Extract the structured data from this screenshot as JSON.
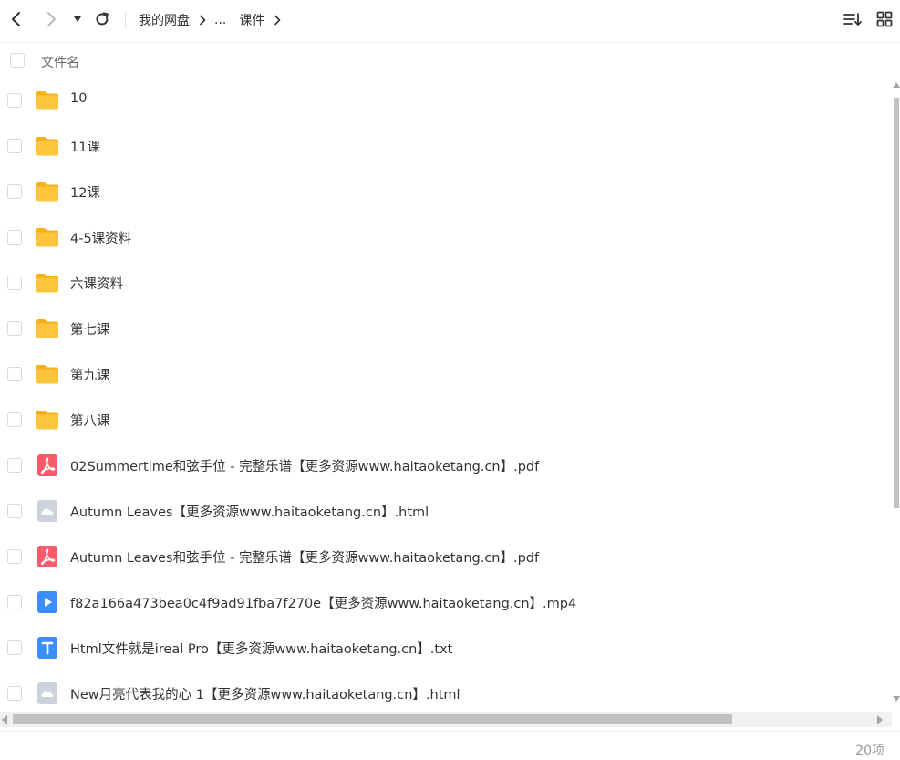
{
  "toolbar": {
    "breadcrumb": [
      {
        "label": "我的网盘"
      },
      {
        "label": "..."
      },
      {
        "label": "课件"
      }
    ]
  },
  "header": {
    "name_column": "文件名"
  },
  "files": [
    {
      "name": "10",
      "type": "folder"
    },
    {
      "name": "11课",
      "type": "folder"
    },
    {
      "name": "12课",
      "type": "folder"
    },
    {
      "name": "4-5课资料",
      "type": "folder"
    },
    {
      "name": "六课资料",
      "type": "folder"
    },
    {
      "name": "第七课",
      "type": "folder"
    },
    {
      "name": "第九课",
      "type": "folder"
    },
    {
      "name": "第八课",
      "type": "folder"
    },
    {
      "name": "02Summertime和弦手位 - 完整乐谱【更多资源www.haitaoketang.cn】.pdf",
      "type": "pdf"
    },
    {
      "name": "Autumn Leaves【更多资源www.haitaoketang.cn】.html",
      "type": "html"
    },
    {
      "name": "Autumn Leaves和弦手位 - 完整乐谱【更多资源www.haitaoketang.cn】.pdf",
      "type": "pdf"
    },
    {
      "name": "f82a166a473bea0c4f9ad91fba7f270e【更多资源www.haitaoketang.cn】.mp4",
      "type": "video"
    },
    {
      "name": "Html文件就是ireal Pro【更多资源www.haitaoketang.cn】.txt",
      "type": "txt"
    },
    {
      "name": "New月亮代表我的心 1【更多资源www.haitaoketang.cn】.html",
      "type": "html"
    }
  ],
  "footer": {
    "item_count": "20项"
  },
  "colors": {
    "folder": "#FFC53D",
    "folder_tab": "#F5B11A",
    "pdf": "#F45C6B",
    "video": "#3A8EF6",
    "txt": "#3A8EF6",
    "html": "#CDD3DC"
  }
}
